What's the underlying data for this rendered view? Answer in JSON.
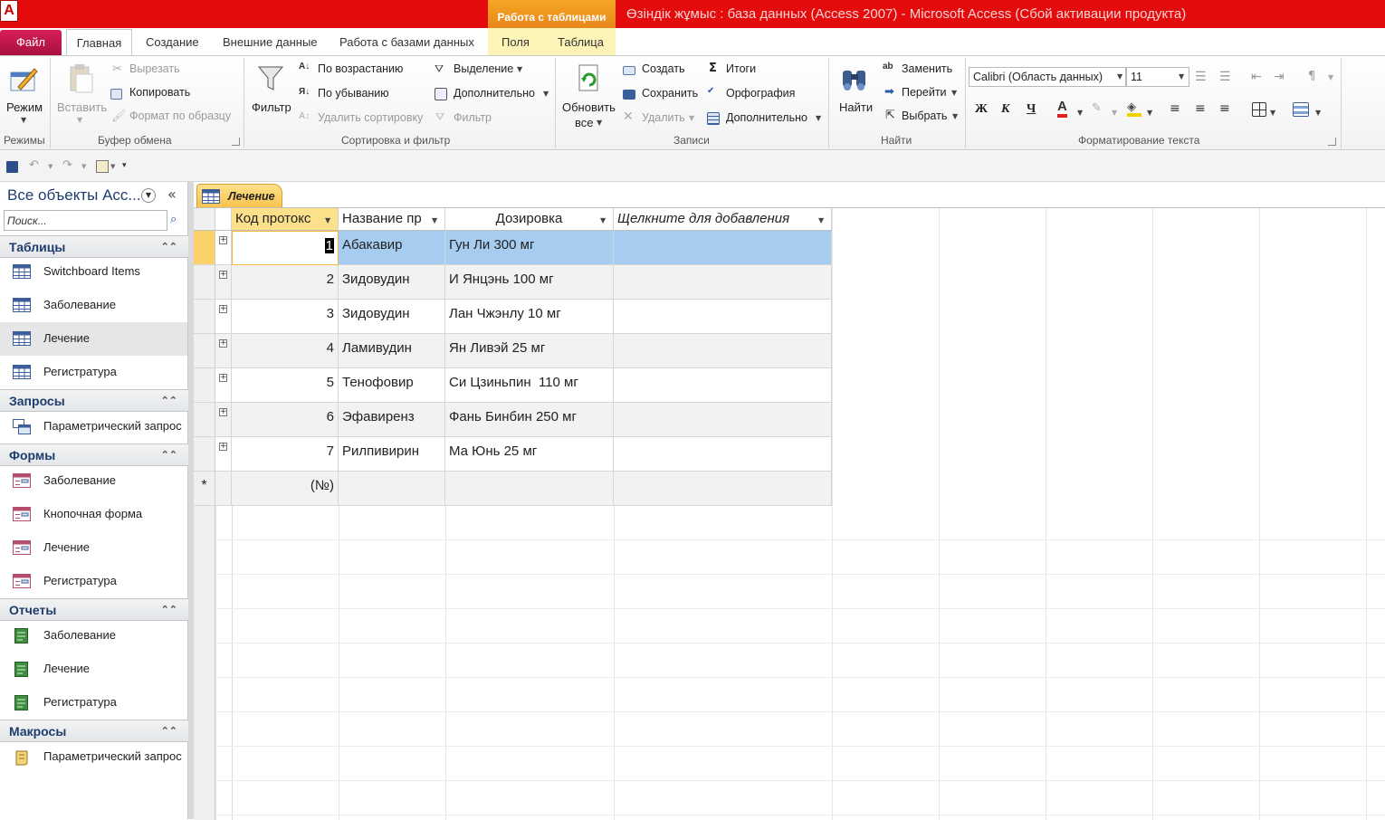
{
  "window": {
    "title": "Өзіндік жұмыс : база данных (Access 2007)  -  Microsoft Access (Сбой активации продукта)",
    "context_group": "Работа с таблицами",
    "app_icon_letter": "A"
  },
  "tabs": {
    "file": "Файл",
    "home": "Главная",
    "create": "Создание",
    "external": "Внешние данные",
    "database": "Работа с базами данных",
    "fields": "Поля",
    "table": "Таблица"
  },
  "ribbon": {
    "views": {
      "mode": "Режим",
      "label": "Режимы"
    },
    "clipboard": {
      "paste": "Вставить",
      "cut": "Вырезать",
      "copy": "Копировать",
      "format_painter": "Формат по образцу",
      "label": "Буфер обмена"
    },
    "sort": {
      "filter": "Фильтр",
      "ascending": "По возрастанию",
      "descending": "По убыванию",
      "remove_sort": "Удалить сортировку",
      "selection": "Выделение",
      "advanced": "Дополнительно",
      "toggle_filter": "Фильтр",
      "label": "Сортировка и фильтр"
    },
    "records": {
      "refresh_1": "Обновить",
      "refresh_2": "все",
      "new": "Создать",
      "save": "Сохранить",
      "delete": "Удалить",
      "totals": "Итоги",
      "spelling": "Орфография",
      "more": "Дополнительно",
      "label": "Записи"
    },
    "find": {
      "find": "Найти",
      "replace": "Заменить",
      "goto": "Перейти",
      "select": "Выбрать",
      "label": "Найти"
    },
    "text": {
      "font": "Calibri (Область данных)",
      "size": "11",
      "bold": "Ж",
      "italic": "К",
      "underline": "Ч",
      "font_color_glyph": "A",
      "label": "Форматирование текста"
    }
  },
  "nav": {
    "title": "Все объекты Acc...",
    "search_placeholder": "Поиск...",
    "groups": [
      {
        "name": "Таблицы",
        "items": [
          "Switchboard Items",
          "Заболевание",
          "Лечение",
          "Регистратура"
        ]
      },
      {
        "name": "Запросы",
        "items": [
          "Параметрический запрос"
        ]
      },
      {
        "name": "Формы",
        "items": [
          "Заболевание",
          "Кнопочная форма",
          "Лечение",
          "Регистратура"
        ]
      },
      {
        "name": "Отчеты",
        "items": [
          "Заболевание",
          "Лечение",
          "Регистратура"
        ]
      },
      {
        "name": "Макросы",
        "items": [
          "Параметрический запрос"
        ]
      }
    ]
  },
  "document": {
    "tab": "Лечение"
  },
  "table": {
    "columns": [
      "Код протокс",
      "Название пр",
      "Дозировка",
      "Щелкните для добавления"
    ],
    "rows": [
      [
        "1",
        "Абакавир",
        "Гун Ли 300 мг",
        ""
      ],
      [
        "2",
        "Зидовудин",
        "И Янцэнь 100 мг",
        ""
      ],
      [
        "3",
        "Зидовудин",
        "Лан Чжэнлу 10 мг",
        ""
      ],
      [
        "4",
        "Ламивудин",
        "Ян Ливэй 25 мг",
        ""
      ],
      [
        "5",
        "Тенофовир",
        "Си Цзиньпин  110 мг",
        ""
      ],
      [
        "6",
        "Эфавиренз",
        "Фань Бинбин 250 мг",
        ""
      ],
      [
        "7",
        "Рилпивирин",
        "Ма Юнь 25 мг",
        ""
      ]
    ],
    "new_row_marker": "*",
    "new_row_id": "(№)",
    "expander_glyph": "+"
  },
  "colors": {
    "title_bar": "#e30b0b",
    "file_tab": "#c0154a",
    "context_tab": "#f5a623",
    "selected_row": "#a6cdf0",
    "doc_tab": "#f8c24a"
  }
}
